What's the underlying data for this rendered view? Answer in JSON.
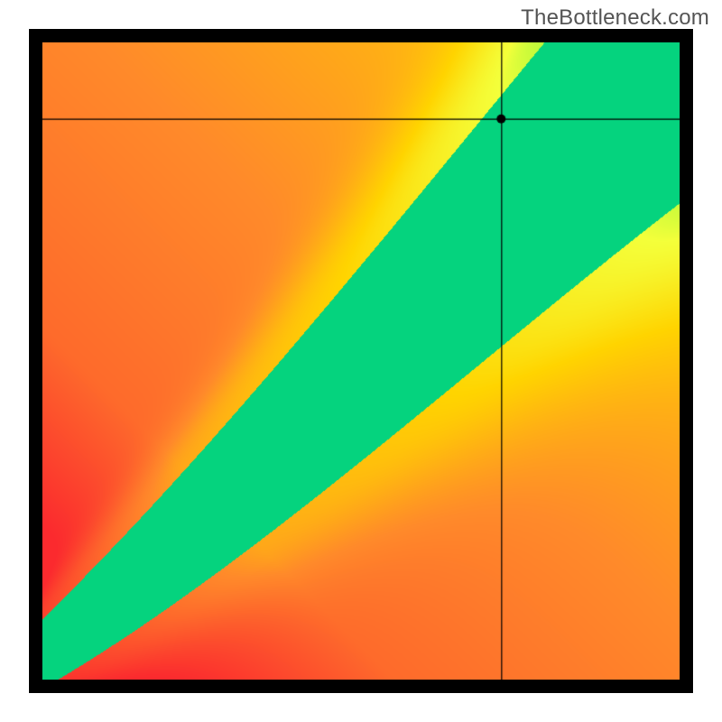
{
  "watermark": "TheBottleneck.com",
  "chart_data": {
    "type": "heatmap",
    "title": "",
    "xlabel": "",
    "ylabel": "",
    "xlim": [
      0,
      100
    ],
    "ylim": [
      0,
      100
    ],
    "grid": false,
    "crosshair": {
      "x": 72,
      "y": 88
    },
    "marker": {
      "x": 72,
      "y": 88
    },
    "green_band": {
      "comment": "diagonal high-fit band; value is fit score 0-1",
      "slope": 1.0,
      "offset": -5,
      "halfwidth": 7
    },
    "color_stops": [
      {
        "score": 0.0,
        "color": "#fb2a2e"
      },
      {
        "score": 0.45,
        "color": "#ff8a2a"
      },
      {
        "score": 0.7,
        "color": "#ffd400"
      },
      {
        "score": 0.85,
        "color": "#f4ff3a"
      },
      {
        "score": 0.95,
        "color": "#6ef23a"
      },
      {
        "score": 1.0,
        "color": "#05d37e"
      }
    ]
  }
}
